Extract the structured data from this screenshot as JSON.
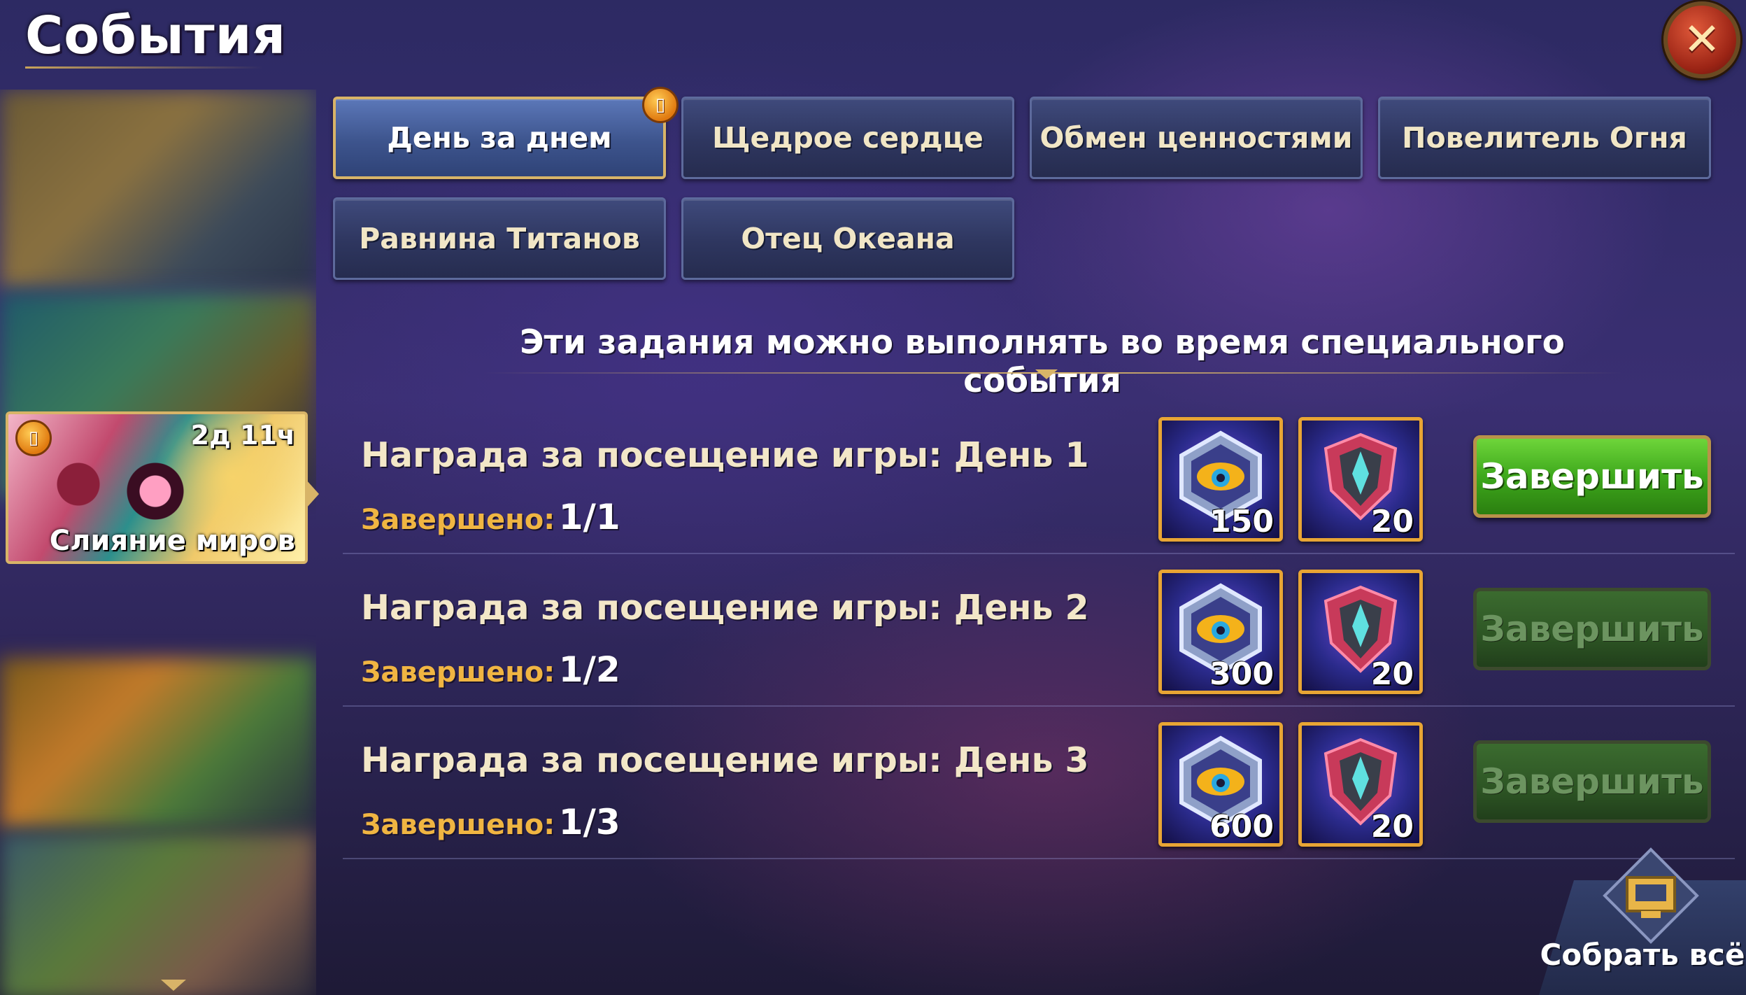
{
  "header": {
    "title": "События"
  },
  "sidebar": {
    "active_event": {
      "timer": "2д 11ч",
      "name": "Слияние миров"
    }
  },
  "tabs": [
    {
      "label": "День за днем",
      "active": true,
      "has_gift": true
    },
    {
      "label": "Щедрое сердце",
      "active": false
    },
    {
      "label": "Обмен ценностями",
      "active": false
    },
    {
      "label": "Повелитель Огня",
      "active": false
    },
    {
      "label": "Равнина Титанов",
      "active": false
    },
    {
      "label": "Отец Океана",
      "active": false
    }
  ],
  "subtitle": "Эти задания можно выполнять во время специального события",
  "quests": [
    {
      "title": "Награда за посещение игры: День 1",
      "progress_label": "Завершено:",
      "progress_value": "1/1",
      "rewards": [
        {
          "icon": "eye-emblem-icon",
          "count": "150"
        },
        {
          "icon": "crest-shield-icon",
          "count": "20"
        }
      ],
      "button_label": "Завершить",
      "button_enabled": true
    },
    {
      "title": "Награда за посещение игры: День 2",
      "progress_label": "Завершено:",
      "progress_value": "1/2",
      "rewards": [
        {
          "icon": "eye-emblem-icon",
          "count": "300"
        },
        {
          "icon": "crest-shield-icon",
          "count": "20"
        }
      ],
      "button_label": "Завершить",
      "button_enabled": false
    },
    {
      "title": "Награда за посещение игры: День 3",
      "progress_label": "Завершено:",
      "progress_value": "1/3",
      "rewards": [
        {
          "icon": "eye-emblem-icon",
          "count": "600"
        },
        {
          "icon": "crest-shield-icon",
          "count": "20"
        }
      ],
      "button_label": "Завершить",
      "button_enabled": false
    }
  ],
  "collect_all": {
    "label": "Собрать всё"
  },
  "colors": {
    "accent_gold": "#d8b468",
    "button_green": "#3ea81c",
    "close_red": "#9b2415"
  }
}
